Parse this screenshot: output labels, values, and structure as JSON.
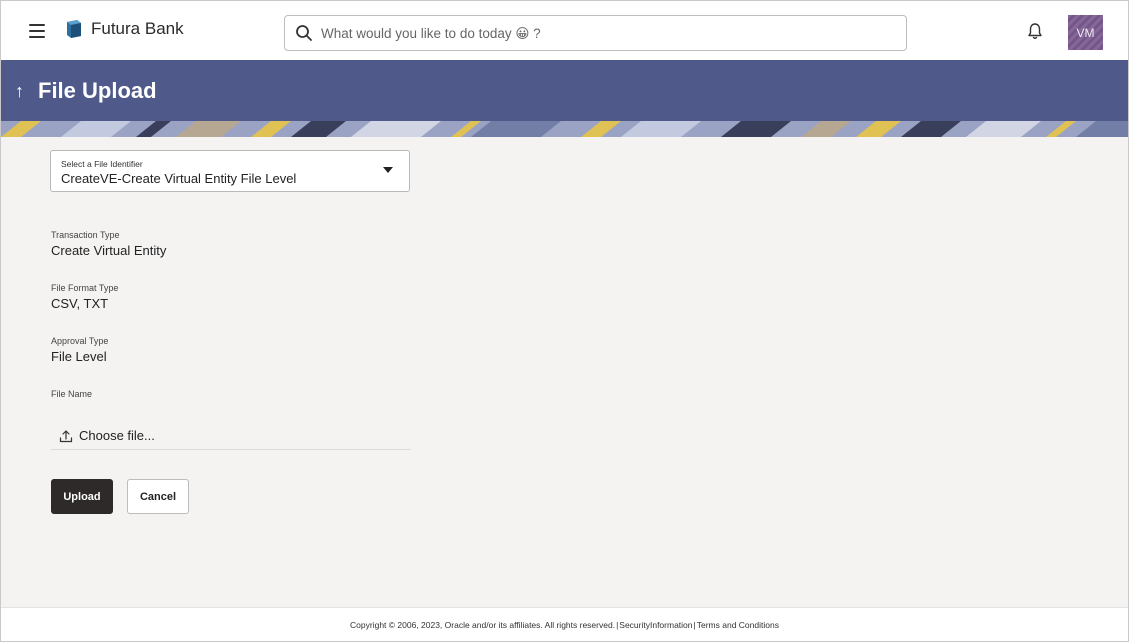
{
  "header": {
    "brand_name": "Futura Bank",
    "search_placeholder": "What would you like to do today 😀 ?",
    "avatar_initials": "VM",
    "colors": {
      "banner": "#4f5a8a",
      "avatar": "#7b5a8f"
    }
  },
  "page": {
    "title": "File Upload"
  },
  "form": {
    "file_identifier": {
      "label": "Select a File Identifier",
      "value": "CreateVE-Create Virtual Entity File Level"
    },
    "transaction_type": {
      "label": "Transaction Type",
      "value": "Create Virtual Entity"
    },
    "file_format_type": {
      "label": "File Format Type",
      "value": "CSV, TXT"
    },
    "approval_type": {
      "label": "Approval Type",
      "value": "File Level"
    },
    "file_name": {
      "label": "File Name",
      "choose_label": "Choose file..."
    },
    "upload_label": "Upload",
    "cancel_label": "Cancel"
  },
  "footer": {
    "copyright": "Copyright © 2006, 2023, Oracle and/or its affiliates. All rights reserved.",
    "security_link": "SecurityInformation",
    "terms_link": "Terms and Conditions",
    "separator": "|"
  }
}
